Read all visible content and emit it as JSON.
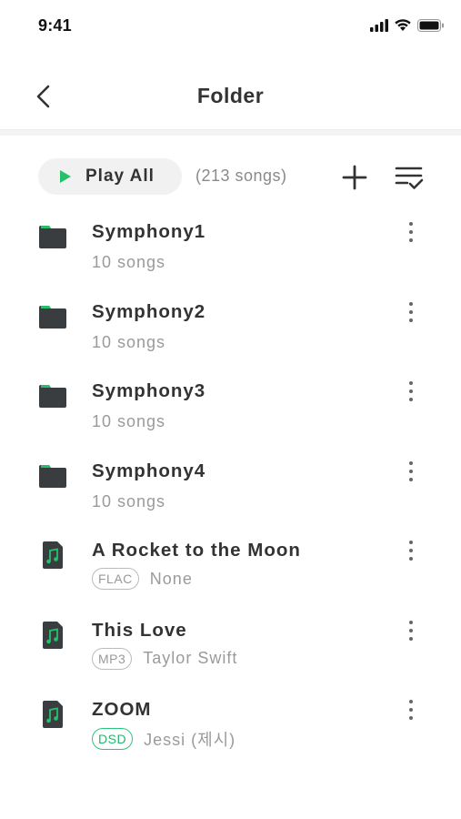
{
  "status_bar": {
    "time": "9:41"
  },
  "header": {
    "title": "Folder",
    "back_icon": "chevron-left-icon"
  },
  "toolbar": {
    "play_all_label": "Play All",
    "song_count": "(213 songs)",
    "add_icon": "plus-icon",
    "sort_icon": "sort-check-icon"
  },
  "colors": {
    "accent": "#24c06a",
    "folder": "#3a3d3f",
    "text_primary": "#333333",
    "text_secondary": "#9a9a9a"
  },
  "folders": [
    {
      "name": "Symphony1",
      "count": "10 songs"
    },
    {
      "name": "Symphony2",
      "count": "10 songs"
    },
    {
      "name": "Symphony3",
      "count": "10 songs"
    },
    {
      "name": "Symphony4",
      "count": "10 songs"
    }
  ],
  "songs": [
    {
      "title": "A Rocket to the Moon",
      "format": "FLAC",
      "artist": "None"
    },
    {
      "title": "This Love",
      "format": "MP3",
      "artist": "Taylor Swift"
    },
    {
      "title": "ZOOM",
      "format": "DSD",
      "artist": "Jessi (제시)"
    }
  ]
}
